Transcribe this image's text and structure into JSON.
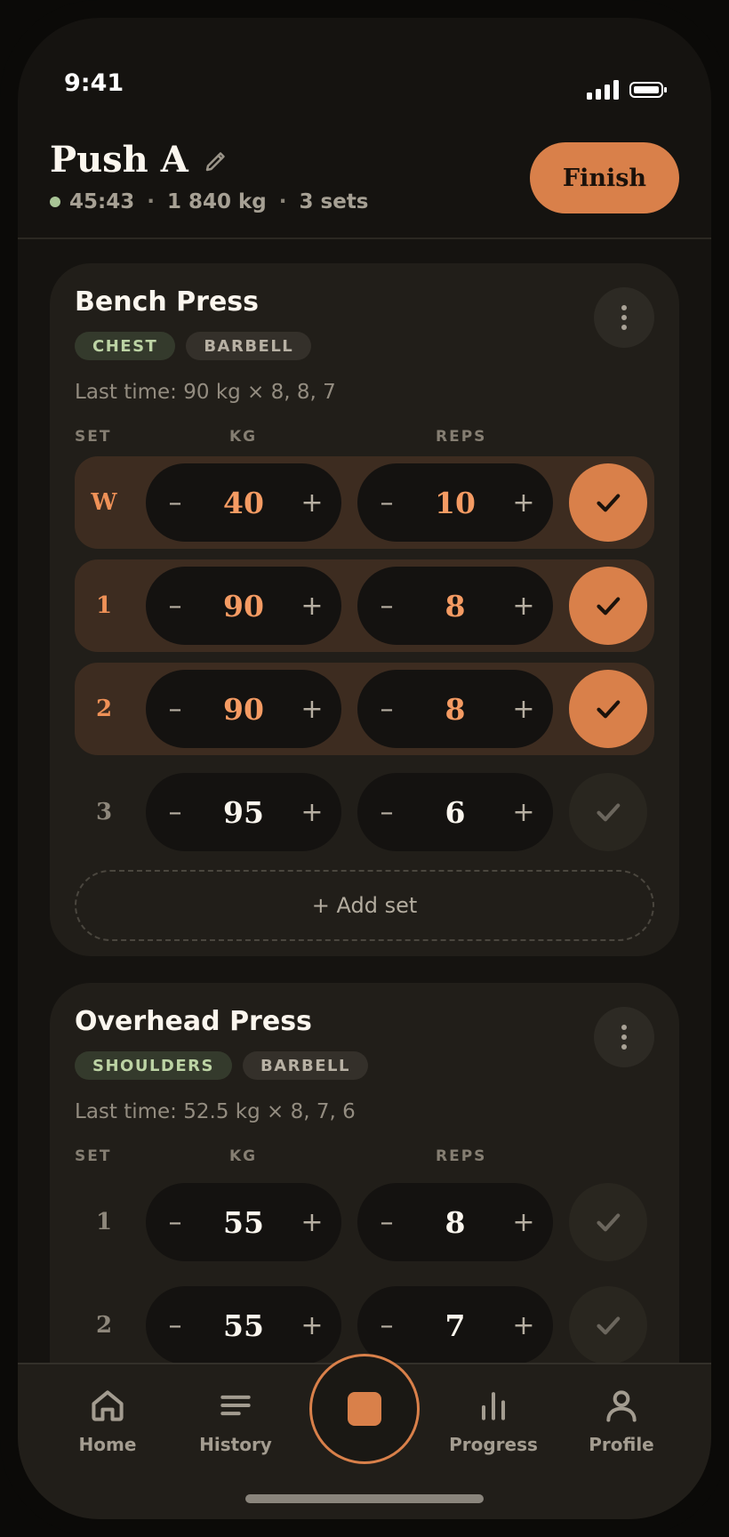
{
  "status_bar": {
    "time": "9:41"
  },
  "header": {
    "title": "Push A",
    "duration": "45:43",
    "volume": "1 840 kg",
    "sets_count": "3 sets",
    "separator": "·",
    "finish_label": "Finish"
  },
  "columns": {
    "set": "SET",
    "kg": "KG",
    "reps": "REPS"
  },
  "stepper": {
    "minus": "–",
    "plus": "+"
  },
  "exercises": [
    {
      "name": "Bench Press",
      "muscle": "CHEST",
      "equipment": "BARBELL",
      "last_time": "Last time: 90 kg × 8, 8, 7",
      "sets": [
        {
          "label": "W",
          "kg": "40",
          "reps": "10",
          "done": true
        },
        {
          "label": "1",
          "kg": "90",
          "reps": "8",
          "done": true
        },
        {
          "label": "2",
          "kg": "90",
          "reps": "8",
          "done": true
        },
        {
          "label": "3",
          "kg": "95",
          "reps": "6",
          "done": false
        }
      ],
      "add_set_label": "+ Add set"
    },
    {
      "name": "Overhead Press",
      "muscle": "SHOULDERS",
      "equipment": "BARBELL",
      "last_time": "Last time: 52.5 kg × 8, 7, 6",
      "sets": [
        {
          "label": "1",
          "kg": "55",
          "reps": "8",
          "done": false
        },
        {
          "label": "2",
          "kg": "55",
          "reps": "7",
          "done": false
        }
      ]
    }
  ],
  "tabbar": {
    "home": "Home",
    "history": "History",
    "progress": "Progress",
    "profile": "Profile"
  },
  "colors": {
    "accent": "#d9804a",
    "background": "#151310",
    "card": "#211e19",
    "done_row": "#3d2c20",
    "live_dot": "#a9c596"
  }
}
